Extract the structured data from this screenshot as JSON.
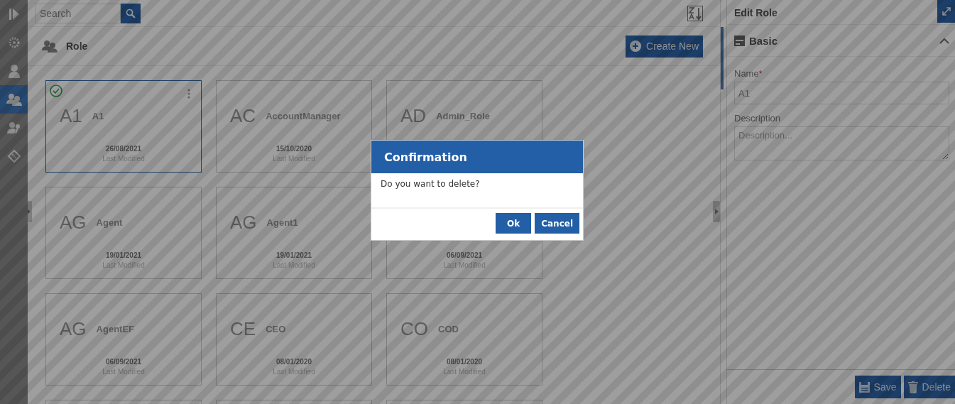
{
  "search": {
    "placeholder": "Search"
  },
  "sidebar": {
    "items": [
      {
        "kind": "expand",
        "selected": false
      },
      {
        "kind": "gear",
        "selected": false
      },
      {
        "kind": "user",
        "selected": false
      },
      {
        "kind": "users",
        "selected": true
      },
      {
        "kind": "user-key",
        "selected": false
      },
      {
        "kind": "ticket",
        "selected": false
      }
    ]
  },
  "header": {
    "title": "Role",
    "create_button": "Create New"
  },
  "cards": [
    {
      "initials": "A1",
      "name": "A1",
      "date": "26/08/2021",
      "date_label": "Last Modified",
      "selected": true
    },
    {
      "initials": "AC",
      "name": "AccountManager",
      "date": "15/10/2020",
      "date_label": "Last Modified",
      "selected": false
    },
    {
      "initials": "AD",
      "name": "Admin_Role",
      "selected": false
    },
    {
      "initials": "AG",
      "name": "Agent",
      "date": "19/01/2021",
      "date_label": "Last Modified",
      "selected": false
    },
    {
      "initials": "AG",
      "name": "Agent1",
      "date": "19/01/2021",
      "date_label": "Last Modified",
      "selected": false
    },
    {
      "date": "06/09/2021",
      "date_label": "Last Modified",
      "selected": false
    },
    {
      "initials": "AG",
      "name": "AgentEF",
      "date": "06/09/2021",
      "date_label": "Last Modified",
      "selected": false
    },
    {
      "initials": "CE",
      "name": "CEO",
      "date": "08/01/2020",
      "date_label": "Last Modified",
      "selected": false
    },
    {
      "initials": "CO",
      "name": "COD",
      "date": "08/01/2020",
      "date_label": "Last Modified",
      "selected": false
    },
    {
      "selected": false
    },
    {
      "selected": false
    },
    {
      "selected": false
    }
  ],
  "edit_panel": {
    "title": "Edit Role",
    "section": {
      "title": "Basic",
      "expanded": true
    },
    "fields": [
      {
        "kind": "input",
        "label": "Name",
        "required_mark": "*",
        "value": "A1"
      },
      {
        "kind": "textarea",
        "label": "Description",
        "placeholder": "Description..."
      }
    ],
    "buttons": [
      {
        "kind": "save",
        "label": "Save"
      },
      {
        "kind": "delete",
        "label": "Delete"
      }
    ]
  },
  "dialog": {
    "title": "Confirmation",
    "message": "Do you want to delete?",
    "buttons": [
      {
        "label": "Ok"
      },
      {
        "label": "Cancel"
      }
    ]
  }
}
